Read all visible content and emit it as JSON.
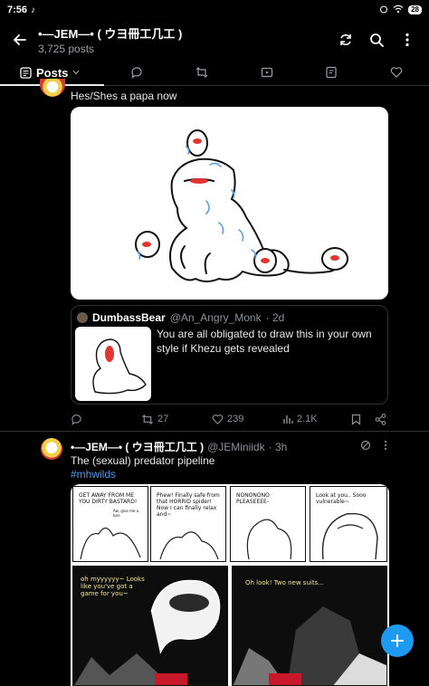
{
  "status_bar": {
    "time": "7:56",
    "battery": "28"
  },
  "header": {
    "name": "•—JEM—• ( ウヨ冊工几工 )",
    "post_count": "3,725 posts"
  },
  "tabs": [
    {
      "label": "Posts"
    }
  ],
  "post1": {
    "text": "Hes/Shes a papa now",
    "quote": {
      "name": "DumbassBear",
      "handle": "@An_Angry_Monk",
      "time": "· 2d",
      "text": "You are all obligated to draw this in your own style if Khezu gets revealed"
    },
    "stats": {
      "retweets": "27",
      "likes": "239",
      "views": "2.1K"
    }
  },
  "post2": {
    "name": "•—JEM—• ( ウヨ冊工几工 )",
    "handle": "@JEMiniidk",
    "time": "· 3h",
    "text": "The (sexual) predator pipeline",
    "hashtag": "#mhwilds",
    "comic": {
      "p1": "GET AWAY FROM ME YOU DIRTY BASTARD!",
      "p1b": "Aw, give me a kiss",
      "p2": "Phew! Finally safe from that HORRID spider! Now I can finally relax and~",
      "p3": "NONONONO PLEASEEEE-",
      "p4": "Look at you.. Sooo vulnerable~",
      "p5": "oh myyyyyy~ Looks like you've got a game for you~",
      "p6": "Oh look! Two new suits..."
    }
  },
  "colors": {
    "accent": "#1d9bf0",
    "background": "#000000"
  },
  "icons": [
    "back-arrow-icon",
    "refresh-icon",
    "search-icon",
    "more-vertical-icon",
    "reply-icon",
    "retweet-icon",
    "like-icon",
    "views-icon",
    "bookmark-icon",
    "share-icon",
    "plus-icon"
  ]
}
